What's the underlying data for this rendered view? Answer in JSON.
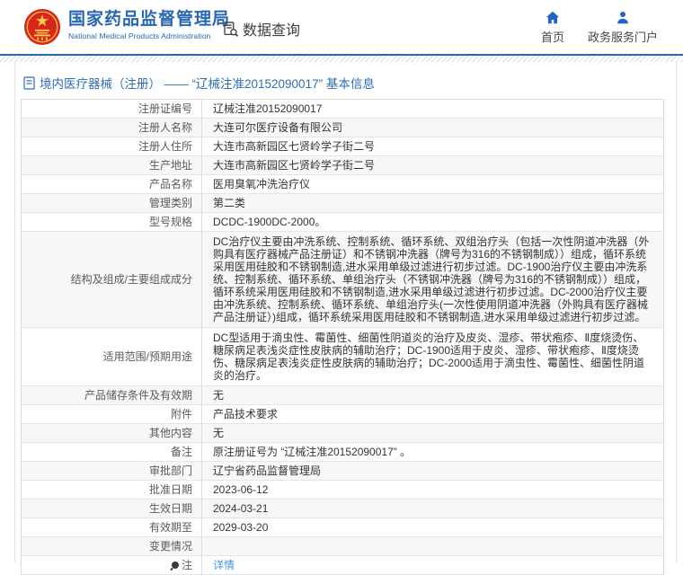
{
  "header": {
    "agency_name_cn": "国家药品监督管理局",
    "agency_name_en": "National Medical Products Administration",
    "data_query_label": "数据查询",
    "nav_home_label": "首页",
    "nav_portal_label": "政务服务门户"
  },
  "breadcrumb": {
    "text": "境内医疗器械（注册） —— “辽械注准20152090017” 基本信息"
  },
  "colors": {
    "brand_blue": "#2767b0",
    "icon_blue": "#2166c4",
    "link_blue": "#4596e6",
    "rule_blue": "#2c67a9",
    "stripe_gray": "#f7f7f7",
    "border_gray": "#dcdcdc"
  },
  "table": {
    "rows": [
      {
        "label": "注册证编号",
        "value": "辽械注准20152090017"
      },
      {
        "label": "注册人名称",
        "value": "大连可尔医疗设备有限公司"
      },
      {
        "label": "注册人住所",
        "value": "大连市高新园区七贤岭学子街二号"
      },
      {
        "label": "生产地址",
        "value": "大连市高新园区七贤岭学子街二号"
      },
      {
        "label": "产品名称",
        "value": "医用臭氧冲洗治疗仪"
      },
      {
        "label": "管理类别",
        "value": "第二类"
      },
      {
        "label": "型号规格",
        "value": "DCDC-1900DC-2000。"
      },
      {
        "label": "结构及组成/主要组成成分",
        "multiline": true,
        "value": "DC治疗仪主要由冲洗系统、控制系统、循环系统、双组治疗头（包括一次性阴道冲洗器（外购具有医疗器械产品注册证）和不锈钢冲洗器（牌号为316的不锈钢制成））组成，循环系统采用医用硅胶和不锈钢制造,进水采用单级过滤进行初步过滤。DC-1900治疗仪主要由冲洗系统、控制系统、循环系统、单组治疗头（不锈钢冲洗器（牌号为316的不锈钢制成））组成，循环系统采用医用硅胶和不锈钢制造,进水采用单级过滤进行初步过滤。DC-2000治疗仪主要由冲洗系统、控制系统、循环系统、单组治疗头(一次性使用阴道冲洗器（外购具有医疗器械产品注册证）)组成，循环系统采用医用硅胶和不锈钢制造,进水采用单级过滤进行初步过滤。"
      },
      {
        "label": "适用范围/预期用途",
        "multiline": true,
        "value": "DC型适用于滴虫性、霉菌性、细菌性阴道炎的治疗及皮炎、湿疹、带状疱疹、Ⅱ度烧烫伤、糖尿病足表浅炎症性皮肤病的辅助治疗；DC-1900适用于皮炎、湿疹、带状疱疹、Ⅱ度烧烫伤、糖尿病足表浅炎症性皮肤病的辅助治疗；DC-2000适用于滴虫性、霉菌性、细菌性阴道炎的治疗。"
      },
      {
        "label": "产品储存条件及有效期",
        "value": "无"
      },
      {
        "label": "附件",
        "value": "产品技术要求"
      },
      {
        "label": "其他内容",
        "value": "无"
      },
      {
        "label": "备注",
        "value": "原注册证号为 “辽械注准20152090017” 。"
      },
      {
        "label": "审批部门",
        "value": "辽宁省药品监督管理局"
      },
      {
        "label": "批准日期",
        "value": "2023-06-12"
      },
      {
        "label": "生效日期",
        "value": "2024-03-21"
      },
      {
        "label": "有效期至",
        "value": "2029-03-20"
      },
      {
        "label": "变更情况",
        "value": ""
      },
      {
        "label": "注",
        "label_icon": "note-icon",
        "value": "详情",
        "value_is_link": true
      }
    ]
  }
}
